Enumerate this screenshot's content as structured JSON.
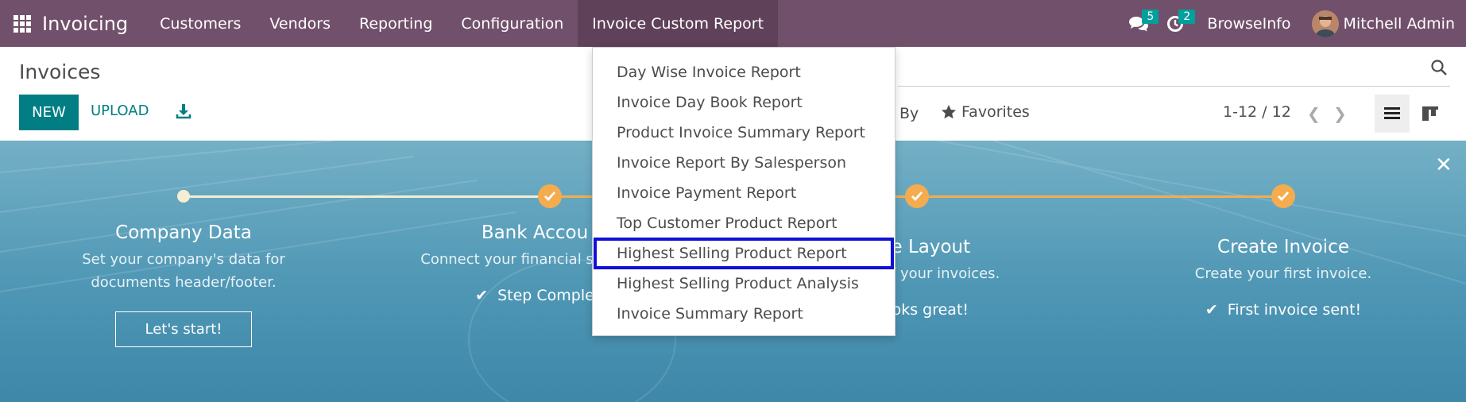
{
  "navbar": {
    "app_name": "Invoicing",
    "menu": [
      {
        "label": "Customers"
      },
      {
        "label": "Vendors"
      },
      {
        "label": "Reporting"
      },
      {
        "label": "Configuration"
      },
      {
        "label": "Invoice Custom Report"
      }
    ],
    "messages_count": "5",
    "activities_count": "2",
    "company": "BrowseInfo",
    "user": "Mitchell Admin"
  },
  "control_panel": {
    "title": "Invoices",
    "new_label": "NEW",
    "upload_label": "UPLOAD",
    "groupby_fragment": "By",
    "favorites_label": "Favorites",
    "pager": "1-12 / 12"
  },
  "dropdown": {
    "items": [
      {
        "label": "Day Wise Invoice Report"
      },
      {
        "label": "Invoice Day Book Report"
      },
      {
        "label": "Product Invoice Summary Report"
      },
      {
        "label": "Invoice Report By Salesperson"
      },
      {
        "label": "Invoice Payment Report"
      },
      {
        "label": "Top Customer Product Report"
      },
      {
        "label": "Highest Selling Product Report"
      },
      {
        "label": "Highest Selling Product Analysis"
      },
      {
        "label": "Invoice Summary Report"
      }
    ],
    "highlighted_index": 6
  },
  "onboarding": {
    "steps": [
      {
        "title": "Company Data",
        "desc": "Set your company's data for documents header/footer.",
        "action": "Let's start!"
      },
      {
        "title": "Bank Accou",
        "desc": "Connect your financial seconds.",
        "status": "Step Comple"
      },
      {
        "title": "ce Layout",
        "desc": "ook of your invoices.",
        "status": "ooks great!"
      },
      {
        "title": "Create Invoice",
        "desc": "Create your first invoice.",
        "status": "First invoice sent!"
      }
    ]
  },
  "colors": {
    "navbar": "#71506b",
    "primary": "#017e84",
    "badge": "#00a09d",
    "step_done": "#f4ac4f",
    "highlight": "#1010d8"
  }
}
